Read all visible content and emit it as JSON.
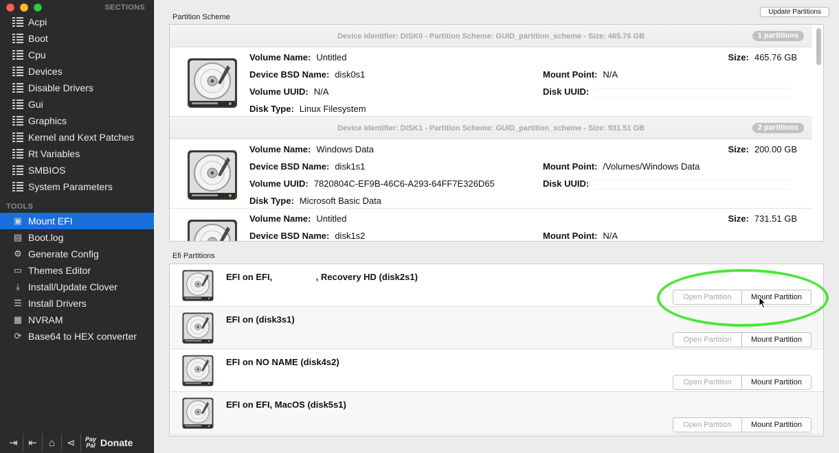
{
  "sidebar": {
    "sections_header": "SECTIONS",
    "tools_header": "TOOLS",
    "sections": [
      {
        "label": "Acpi"
      },
      {
        "label": "Boot"
      },
      {
        "label": "Cpu"
      },
      {
        "label": "Devices"
      },
      {
        "label": "Disable Drivers"
      },
      {
        "label": "Gui"
      },
      {
        "label": "Graphics"
      },
      {
        "label": "Kernel and Kext Patches"
      },
      {
        "label": "Rt Variables"
      },
      {
        "label": "SMBIOS"
      },
      {
        "label": "System Parameters"
      }
    ],
    "tools": [
      {
        "label": "Mount EFI",
        "icon": "mount-efi-icon",
        "glyph": "▣"
      },
      {
        "label": "Boot.log",
        "icon": "document-icon",
        "glyph": "▤"
      },
      {
        "label": "Generate Config",
        "icon": "gear-icon",
        "glyph": "⚙"
      },
      {
        "label": "Themes Editor",
        "icon": "themes-icon",
        "glyph": "▭"
      },
      {
        "label": "Install/Update Clover",
        "icon": "download-icon",
        "glyph": "⤓"
      },
      {
        "label": "Install Drivers",
        "icon": "list-icon",
        "glyph": "☰"
      },
      {
        "label": "NVRAM",
        "icon": "chip-icon",
        "glyph": "▦"
      },
      {
        "label": "Base64 to HEX converter",
        "icon": "convert-icon",
        "glyph": "⟳"
      }
    ],
    "active_tool": "Mount EFI",
    "donate_label": "Donate",
    "paypal_line1": "Pay",
    "paypal_line2": "Pal"
  },
  "header": {
    "partition_scheme_label": "Partition Scheme",
    "update_button": "Update Partitions",
    "efi_partitions_label": "Efi Partitions"
  },
  "devices": [
    {
      "header": "Device Identifier: DISK0 - Partition Scheme: GUID_partition_scheme - Size: 465.76 GB",
      "badge": "1 partitions",
      "volumes": [
        {
          "volume_name": "Untitled",
          "bsd_name": "disk0s1",
          "volume_uuid": "N/A",
          "disk_type": "Linux Filesystem",
          "size": "465.76 GB",
          "mount_point": "N/A"
        }
      ]
    },
    {
      "header": "Device Identifier: DISK1 - Partition Scheme: GUID_partition_scheme - Size: 931.51 GB",
      "badge": "2 partitions",
      "volumes": [
        {
          "volume_name": "Windows Data",
          "bsd_name": "disk1s1",
          "volume_uuid": "7820804C-EF9B-46C6-A293-64FF7E326D65",
          "disk_type": "Microsoft Basic Data",
          "size": "200.00 GB",
          "mount_point": "/Volumes/Windows Data"
        },
        {
          "volume_name": "Untitled",
          "bsd_name": "disk1s2",
          "size": "731.51 GB",
          "mount_point": "N/A"
        }
      ]
    }
  ],
  "field_labels": {
    "volume_name": "Volume Name:",
    "bsd_name": "Device BSD Name:",
    "volume_uuid": "Volume UUID:",
    "disk_type": "Disk Type:",
    "size": "Size:",
    "mount_point": "Mount Point:",
    "disk_uuid": "Disk UUID:"
  },
  "efi_partitions": [
    {
      "title_pre": "EFI on EFI, ",
      "title_post": ", Recovery HD (disk2s1)",
      "redacted": true
    },
    {
      "title": "EFI on  (disk3s1)"
    },
    {
      "title": "EFI on NO NAME (disk4s2)"
    },
    {
      "title": "EFI on EFI, MacOS (disk5s1)"
    }
  ],
  "buttons": {
    "open_partition": "Open Partition",
    "mount_partition": "Mount Partition"
  },
  "colors": {
    "sidebar_bg": "#2b2b2d",
    "selection": "#1a6fdc",
    "highlight_ring": "#4ee43c"
  }
}
